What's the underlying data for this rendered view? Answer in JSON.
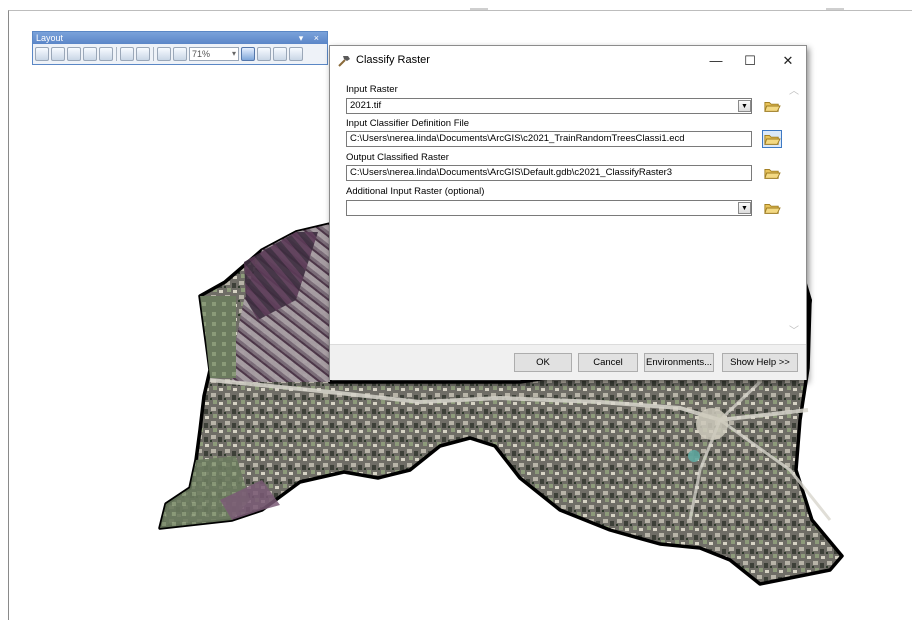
{
  "layout_toolbar": {
    "title": "Layout",
    "zoom_value": "71%",
    "title_controls": "▾ ×"
  },
  "dialog": {
    "title": "Classify Raster",
    "window_controls": {
      "minimize": "—",
      "maximize": "☐",
      "close": "✕"
    },
    "fields": [
      {
        "label": "Input Raster",
        "value": "2021.tif",
        "type": "combo"
      },
      {
        "label": "Input Classifier Definition File",
        "value": "C:\\Users\\nerea.linda\\Documents\\ArcGIS\\c2021_TrainRandomTreesClassi1.ecd",
        "type": "text"
      },
      {
        "label": "Output Classified Raster",
        "value": "C:\\Users\\nerea.linda\\Documents\\ArcGIS\\Default.gdb\\c2021_ClassifyRaster3",
        "type": "text"
      },
      {
        "label": "Additional Input Raster (optional)",
        "value": "",
        "type": "combo"
      }
    ],
    "buttons": {
      "ok": "OK",
      "cancel": "Cancel",
      "environments": "Environments...",
      "show_help": "Show Help >>"
    }
  },
  "icons": {
    "title_icon": "hammer-icon",
    "browse": "folder-open-icon",
    "combo": "chevron-down-icon"
  },
  "colors": {
    "dialog_bg": "#ffffff",
    "footer_bg": "#f0f0f0",
    "toolbar_title": "#5b86c8",
    "active_browse": "#3d79c4"
  }
}
